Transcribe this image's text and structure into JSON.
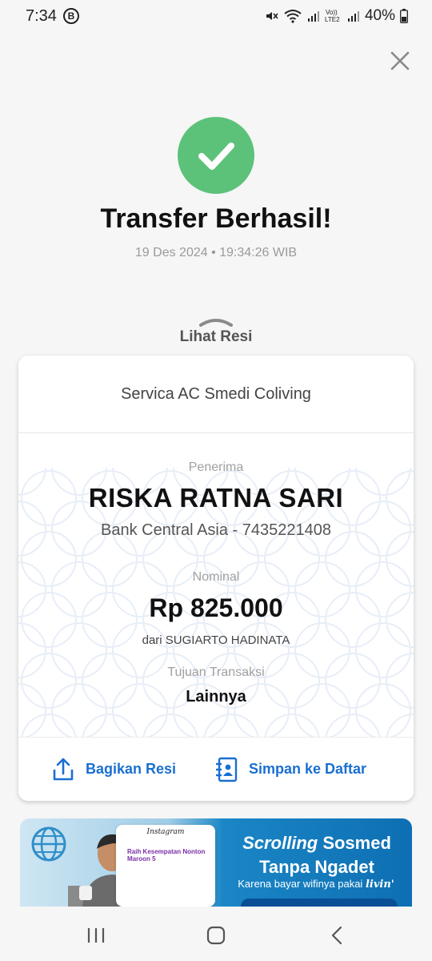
{
  "status_bar": {
    "time": "7:34",
    "badge": "B",
    "battery": "40%"
  },
  "header": {
    "title": "Transfer Berhasil!",
    "datetime": "19 Des 2024 • 19:34:26 WIB"
  },
  "receipt_toggle": {
    "label": "Lihat Resi"
  },
  "card": {
    "description": "Servica AC Smedi Coliving",
    "recipient_label": "Penerima",
    "recipient_name": "RISKA RATNA SARI",
    "recipient_bank": "Bank Central Asia - 7435221408",
    "nominal_label": "Nominal",
    "nominal_value": "Rp 825.000",
    "nominal_from": "dari SUGIARTO HADINATA",
    "purpose_label": "Tujuan Transaksi",
    "purpose_value": "Lainnya",
    "share_label": "Bagikan Resi",
    "save_label": "Simpan ke Daftar"
  },
  "banner": {
    "title_italic": "Scrolling",
    "title_rest": " Sosmed",
    "title_line2": "Tanpa Ngadet",
    "subtitle": "Karena bayar wifinya pakai",
    "brand": "livin'",
    "app_name": "Instagram",
    "promo_text": "Raih Kesempatan Nonton Maroon 5"
  },
  "colors": {
    "success": "#5cc27a",
    "accent": "#1a6fd1",
    "banner_blue": "#0e6fb3"
  },
  "icons": [
    "close-icon",
    "check-icon",
    "share-icon",
    "contact-book-icon",
    "globe-icon",
    "recent-apps-icon",
    "home-icon",
    "back-icon"
  ]
}
